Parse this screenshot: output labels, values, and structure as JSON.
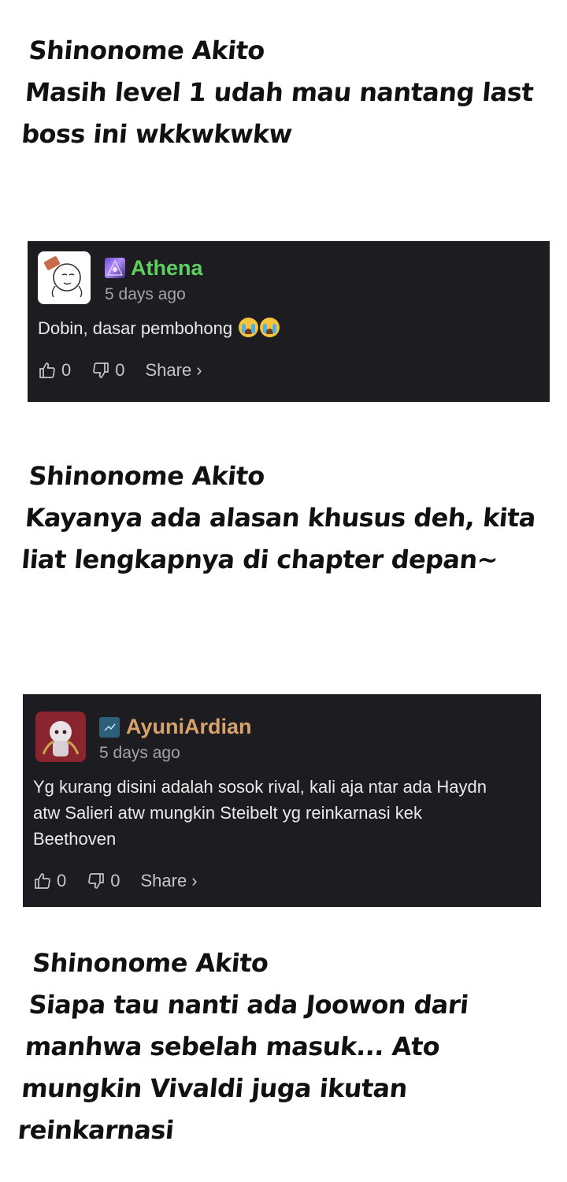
{
  "replies": [
    {
      "author": "Shinonome Akito",
      "text": "Masih level 1 udah mau nantang last boss ini wkkwkwkw"
    },
    {
      "author": "Shinonome Akito",
      "text": "Kayanya ada alasan khusus deh, kita liat lengkapnya di chapter depan~"
    },
    {
      "author": "Shinonome Akito",
      "text": "Siapa tau nanti ada Joowon dari manhwa sebelah masuk... Ato mungkin Vivaldi juga ikutan reinkarnasi"
    }
  ],
  "comments": [
    {
      "username": "Athena",
      "username_color": "#5fcf5f",
      "time": "5 days ago",
      "text": "Dobin, dasar pembohong",
      "emoji": [
        "loudly-crying-face",
        "loudly-crying-face"
      ],
      "likes": "0",
      "dislikes": "0",
      "share_label": "Share",
      "share_chevron": "›",
      "avatar_icon": "doodle-character-avatar",
      "badge_icon": "purple-crystal-badge"
    },
    {
      "username": "AyuniArdian",
      "username_color": "#d8a36a",
      "time": "5 days ago",
      "text": "Yg kurang disini adalah sosok rival, kali aja ntar ada Haydn atw Salieri atw mungkin Steibelt yg reinkarnasi kek Beethoven",
      "likes": "0",
      "dislikes": "0",
      "share_label": "Share",
      "share_chevron": "›",
      "avatar_icon": "anime-character-avatar",
      "badge_icon": "blue-badge"
    }
  ],
  "colors": {
    "card_background": "#1c1c21",
    "page_background": "#ffffff",
    "reply_text": "#111111"
  }
}
